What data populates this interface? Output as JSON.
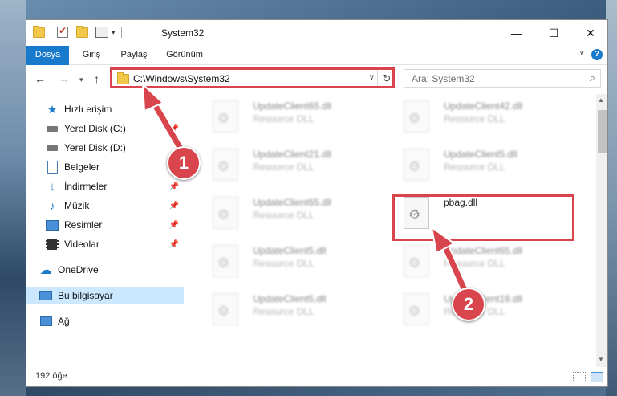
{
  "window": {
    "title": "System32",
    "min": "—",
    "max": "☐",
    "close": "✕"
  },
  "ribbon": {
    "tabs": [
      "Dosya",
      "Giriş",
      "Paylaş",
      "Görünüm"
    ],
    "help": "?"
  },
  "nav": {
    "address": "C:\\Windows\\System32",
    "search_placeholder": "Ara: System32"
  },
  "sidebar": {
    "items": [
      {
        "label": "Hızlı erişim",
        "icon": "star-icon"
      },
      {
        "label": "Yerel Disk (C:)",
        "icon": "drive-icon"
      },
      {
        "label": "Yerel Disk (D:)",
        "icon": "drive-icon"
      },
      {
        "label": "Belgeler",
        "icon": "document-icon"
      },
      {
        "label": "İndirmeler",
        "icon": "download-icon"
      },
      {
        "label": "Müzik",
        "icon": "music-icon"
      },
      {
        "label": "Resimler",
        "icon": "pictures-icon"
      },
      {
        "label": "Videolar",
        "icon": "video-icon"
      },
      {
        "label": "OneDrive",
        "icon": "cloud-icon"
      },
      {
        "label": "Bu bilgisayar",
        "icon": "computer-icon"
      },
      {
        "label": "Ağ",
        "icon": "network-icon"
      }
    ]
  },
  "files": [
    {
      "name": "UpdateClient65.dll",
      "type": "Resource DLL"
    },
    {
      "name": "UpdateClient42.dll",
      "type": "Resource DLL"
    },
    {
      "name": "UpdateClient21.dll",
      "type": "Resource DLL"
    },
    {
      "name": "UpdateClient5.dll",
      "type": "Resource DLL"
    },
    {
      "name": "UpdateClient65.dll",
      "type": "Resource DLL"
    },
    {
      "name": "pbag.dll",
      "type": ""
    },
    {
      "name": "UpdateClient5.dll",
      "type": "Resource DLL"
    },
    {
      "name": "UpdateClient65.dll",
      "type": "Resource DLL"
    },
    {
      "name": "UpdateClient5.dll",
      "type": "Resource DLL"
    },
    {
      "name": "UpdateClient19.dll",
      "type": "Resource DLL"
    }
  ],
  "status": {
    "count": "192 öğe"
  },
  "callouts": [
    "1",
    "2"
  ],
  "colors": {
    "highlight": "#d9454c",
    "accent": "#1979ca",
    "selected": "#cce8ff"
  }
}
